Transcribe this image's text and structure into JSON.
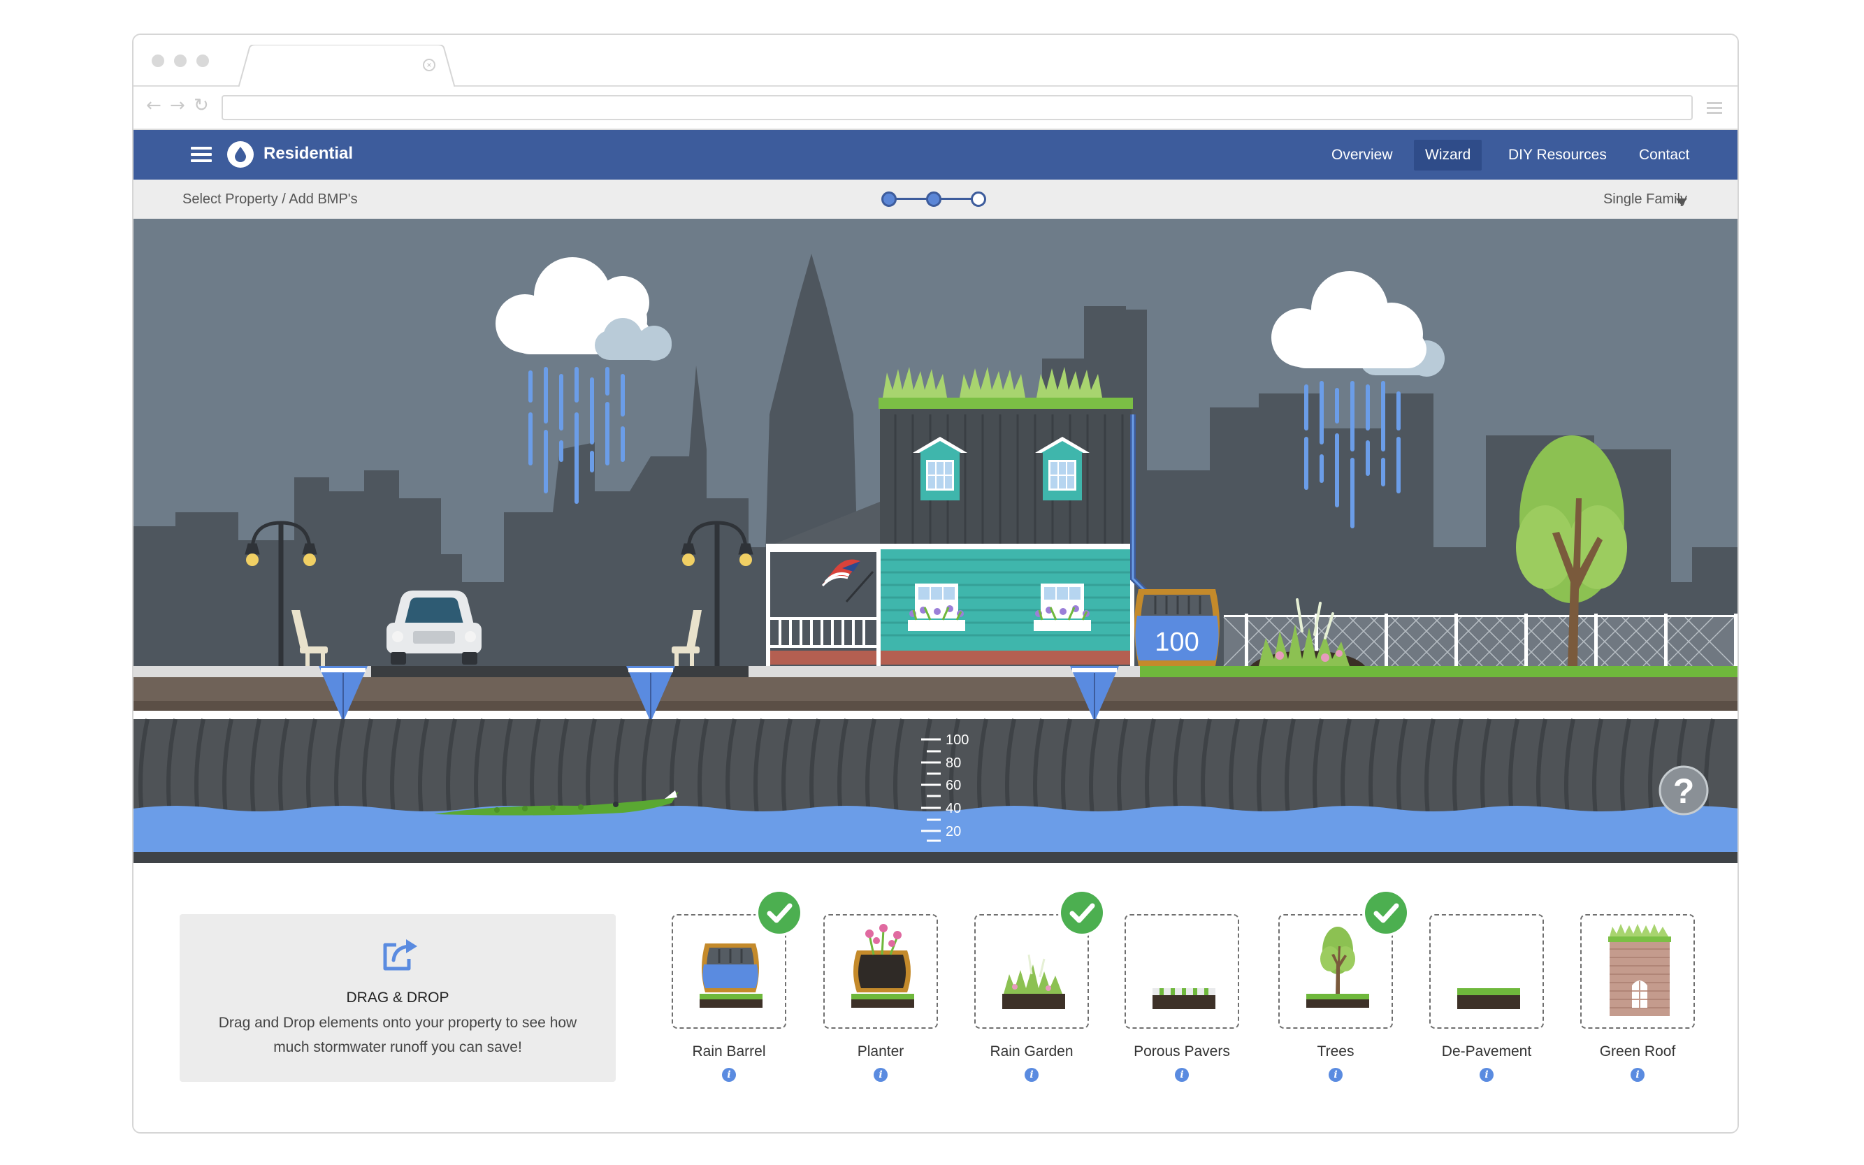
{
  "app": {
    "title": "Residential",
    "nav": [
      {
        "label": "Overview",
        "active": false
      },
      {
        "label": "Wizard",
        "active": true
      },
      {
        "label": "DIY Resources",
        "active": false
      },
      {
        "label": "Contact",
        "active": false
      }
    ]
  },
  "subbar": {
    "breadcrumb": "Select Property / Add BMP's",
    "steps_completed": 2,
    "steps_total": 3,
    "property_type": "Single Family"
  },
  "scene": {
    "rain_barrel_value": "100",
    "gauge_ticks": [
      "100",
      "80",
      "60",
      "40",
      "20"
    ],
    "help_label": "?"
  },
  "drag_drop": {
    "title": "DRAG & DROP",
    "text": "Drag and Drop elements onto your property to see how much stormwater runoff you can save!"
  },
  "bmps": [
    {
      "label": "Rain Barrel",
      "selected": true,
      "icon": "rain-barrel-icon"
    },
    {
      "label": "Planter",
      "selected": false,
      "icon": "planter-icon"
    },
    {
      "label": "Rain Garden",
      "selected": true,
      "icon": "rain-garden-icon"
    },
    {
      "label": "Porous Pavers",
      "selected": false,
      "icon": "porous-pavers-icon"
    },
    {
      "label": "Trees",
      "selected": true,
      "icon": "trees-icon"
    },
    {
      "label": "De-Pavement",
      "selected": false,
      "icon": "de-pavement-icon"
    },
    {
      "label": "Green Roof",
      "selected": false,
      "icon": "green-roof-icon"
    }
  ],
  "colors": {
    "header": "#3d5c9c",
    "sky": "#6e7c89",
    "water": "#6b9de8",
    "grass": "#6fb83c",
    "check": "#4caf50"
  }
}
